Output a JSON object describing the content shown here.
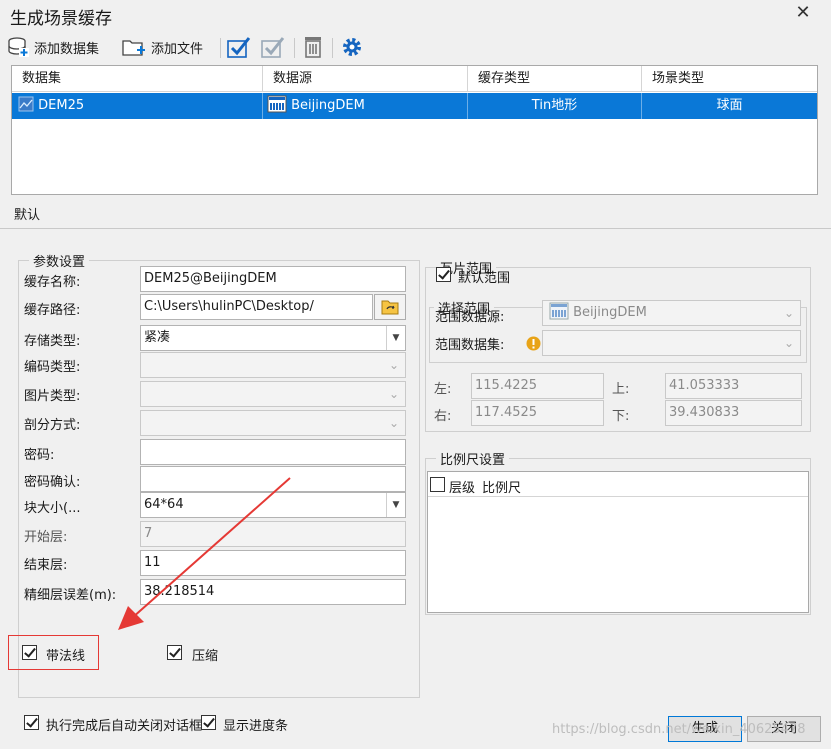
{
  "window": {
    "title": "生成场景缓存"
  },
  "toolbar": {
    "add_dataset": "添加数据集",
    "add_file": "添加文件"
  },
  "grid": {
    "headers": [
      "数据集",
      "数据源",
      "缓存类型",
      "场景类型"
    ],
    "rows": [
      {
        "dataset": "DEM25",
        "datasource": "BeijingDEM",
        "cache_type": "Tin地形",
        "scene_type": "球面"
      }
    ]
  },
  "tab": {
    "label": "默认"
  },
  "params": {
    "legend": "参数设置",
    "cache_name_label": "缓存名称:",
    "cache_name": "DEM25@BeijingDEM",
    "cache_path_label": "缓存路径:",
    "cache_path": "C:\\Users\\hulinPC\\Desktop/",
    "storage_type_label": "存储类型:",
    "storage_type": "紧凑",
    "encoding_label": "编码类型:",
    "image_type_label": "图片类型:",
    "split_label": "剖分方式:",
    "password_label": "密码:",
    "password_confirm_label": "密码确认:",
    "tile_size_label": "块大小(...",
    "tile_size": "64*64",
    "start_level_label": "开始层:",
    "start_level": "7",
    "end_level_label": "结束层:",
    "end_level": "11",
    "fine_error_label": "精细层误差(m):",
    "fine_error": "38.218514",
    "with_normal": "带法线",
    "compress": "压缩"
  },
  "tile_range": {
    "legend": "瓦片范围",
    "default_range": "默认范围",
    "select_legend": "选择范围",
    "range_datasource_label": "范围数据源:",
    "range_datasource": "BeijingDEM",
    "range_dataset_label": "范围数据集:",
    "left_label": "左:",
    "left": "115.4225",
    "top_label": "上:",
    "top": "41.053333",
    "right_label": "右:",
    "right": "117.4525",
    "bottom_label": "下:",
    "bottom": "39.430833"
  },
  "scale": {
    "legend": "比例尺设置",
    "level_header": "层级",
    "scale_header": "比例尺"
  },
  "footer": {
    "auto_close": "执行完成后自动关闭对话框",
    "show_progress": "显示进度条",
    "generate": "生成",
    "close": "关闭"
  },
  "watermark": "https://blog.csdn.net/weixin_40625478"
}
